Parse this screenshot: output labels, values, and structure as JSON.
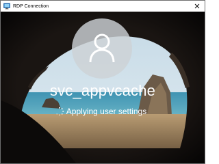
{
  "window": {
    "title": "RDP Connection",
    "app_icon": "rdp-icon",
    "close_icon": "close-icon"
  },
  "login": {
    "avatar_icon": "user-icon",
    "username": "svc_appvcache",
    "status_icon": "loading-spinner-icon",
    "status_text": "Applying user settings"
  },
  "colors": {
    "avatar_background": "#cdd2d6",
    "text": "#ffffff",
    "sea": "#4a9bb5",
    "sky": "#c9dde9"
  }
}
